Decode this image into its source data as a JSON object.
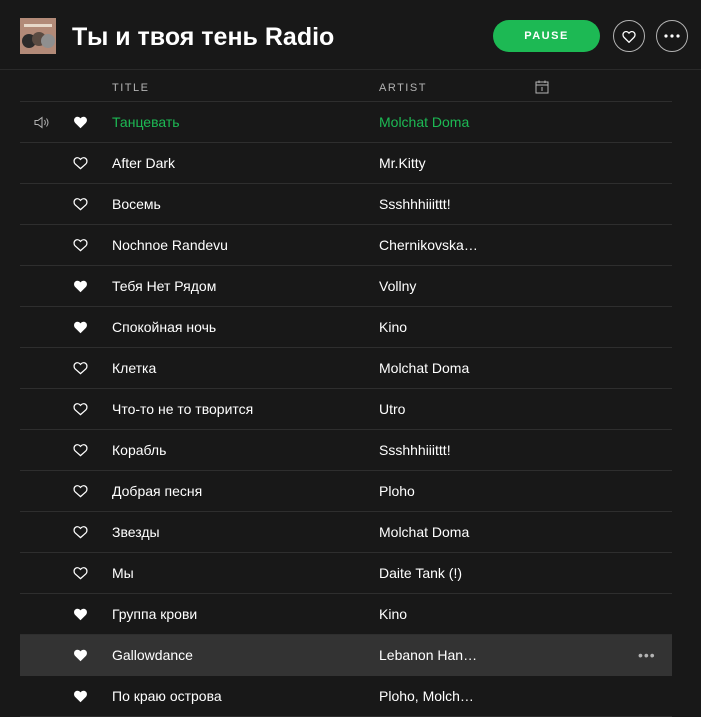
{
  "header": {
    "title": "Ты и твоя тень Radio",
    "pause_label": "PAUSE",
    "cover_alt": "playlist-cover"
  },
  "columns": {
    "title": "TITLE",
    "artist": "ARTIST",
    "date_icon": "calendar-icon"
  },
  "colors": {
    "accent": "#1db954",
    "background": "#181818",
    "row_hover": "#333333",
    "divider": "#2e2e2e"
  },
  "tracks": [
    {
      "title": "Танцевать",
      "artist": "Molchat Doma",
      "liked": true,
      "playing": true
    },
    {
      "title": "After Dark",
      "artist": "Mr.Kitty",
      "liked": false
    },
    {
      "title": "Восемь",
      "artist": "Ssshhhiiittt!",
      "liked": false
    },
    {
      "title": "Nochnoe Randevu",
      "artist": "Chernikovska…",
      "liked": false
    },
    {
      "title": "Тебя Нет Рядом",
      "artist": "Vollny",
      "liked": true
    },
    {
      "title": "Спокойная ночь",
      "artist": "Kino",
      "liked": true
    },
    {
      "title": "Клетка",
      "artist": "Molchat Doma",
      "liked": false
    },
    {
      "title": "Что-то не то творится",
      "artist": "Utro",
      "liked": false
    },
    {
      "title": "Корабль",
      "artist": "Ssshhhiiittt!",
      "liked": false
    },
    {
      "title": "Добрая песня",
      "artist": "Ploho",
      "liked": false
    },
    {
      "title": "Звезды",
      "artist": "Molchat Doma",
      "liked": false
    },
    {
      "title": "Мы",
      "artist": "Daite Tank (!)",
      "liked": false
    },
    {
      "title": "Группа крови",
      "artist": "Kino",
      "liked": true
    },
    {
      "title": "Gallowdance",
      "artist": "Lebanon Han…",
      "liked": true,
      "hovered": true,
      "more_label": "•••"
    },
    {
      "title": "По краю острова",
      "artist": "Ploho, Molch…",
      "liked": true
    }
  ]
}
